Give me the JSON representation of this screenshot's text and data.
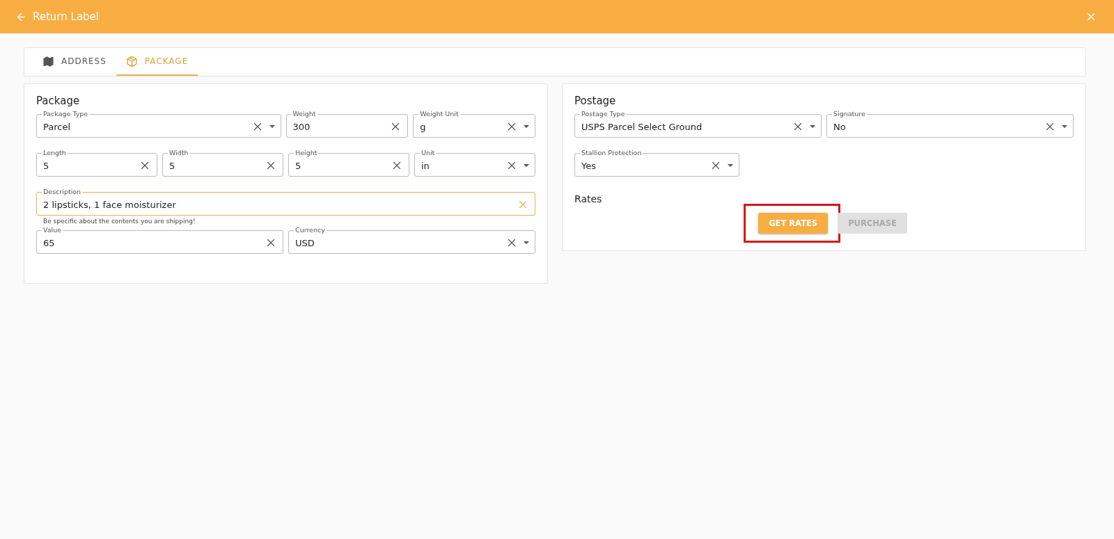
{
  "header": {
    "title": "Return Label"
  },
  "tabs": [
    {
      "label": "ADDRESS",
      "selected": false
    },
    {
      "label": "PACKAGE",
      "selected": true
    }
  ],
  "package": {
    "title": "Package",
    "rows": [
      {
        "fields": [
          {
            "label": "Package Type",
            "value": "Parcel",
            "kind": "select",
            "focused": false
          },
          {
            "label": "Weight",
            "value": "300",
            "kind": "text",
            "focused": false
          },
          {
            "label": "Weight Unit",
            "value": "g",
            "kind": "select",
            "focused": false
          }
        ]
      },
      {
        "fields": [
          {
            "label": "Length",
            "value": "5",
            "kind": "text",
            "focused": false
          },
          {
            "label": "Width",
            "value": "5",
            "kind": "text",
            "focused": false
          },
          {
            "label": "Height",
            "value": "5",
            "kind": "text",
            "focused": false
          },
          {
            "label": "Unit",
            "value": "in",
            "kind": "select",
            "focused": false
          }
        ]
      },
      {
        "fields": [
          {
            "label": "Description",
            "value": "2 lipsticks, 1 face moisturizer",
            "kind": "text",
            "focused": true,
            "helper": "Be specific about the contents you are shipping!"
          }
        ]
      },
      {
        "fields": [
          {
            "label": "Value",
            "value": "65",
            "kind": "text",
            "focused": false
          },
          {
            "label": "Currency",
            "value": "USD",
            "kind": "select",
            "focused": false
          }
        ]
      }
    ]
  },
  "postage": {
    "title": "Postage",
    "rows": [
      {
        "fields": [
          {
            "label": "Postage Type",
            "value": "USPS Parcel Select Ground",
            "kind": "select",
            "focused": false
          },
          {
            "label": "Signature",
            "value": "No",
            "kind": "select",
            "focused": false
          }
        ]
      },
      {
        "fields": [
          {
            "label": "Stallion Protection",
            "value": "Yes",
            "kind": "select",
            "focused": false
          }
        ]
      }
    ],
    "rates_title": "Rates",
    "buttons": [
      {
        "label": "GET RATES",
        "disabled": false,
        "highlighted": true
      },
      {
        "label": "PURCHASE",
        "disabled": true,
        "highlighted": false
      }
    ]
  }
}
